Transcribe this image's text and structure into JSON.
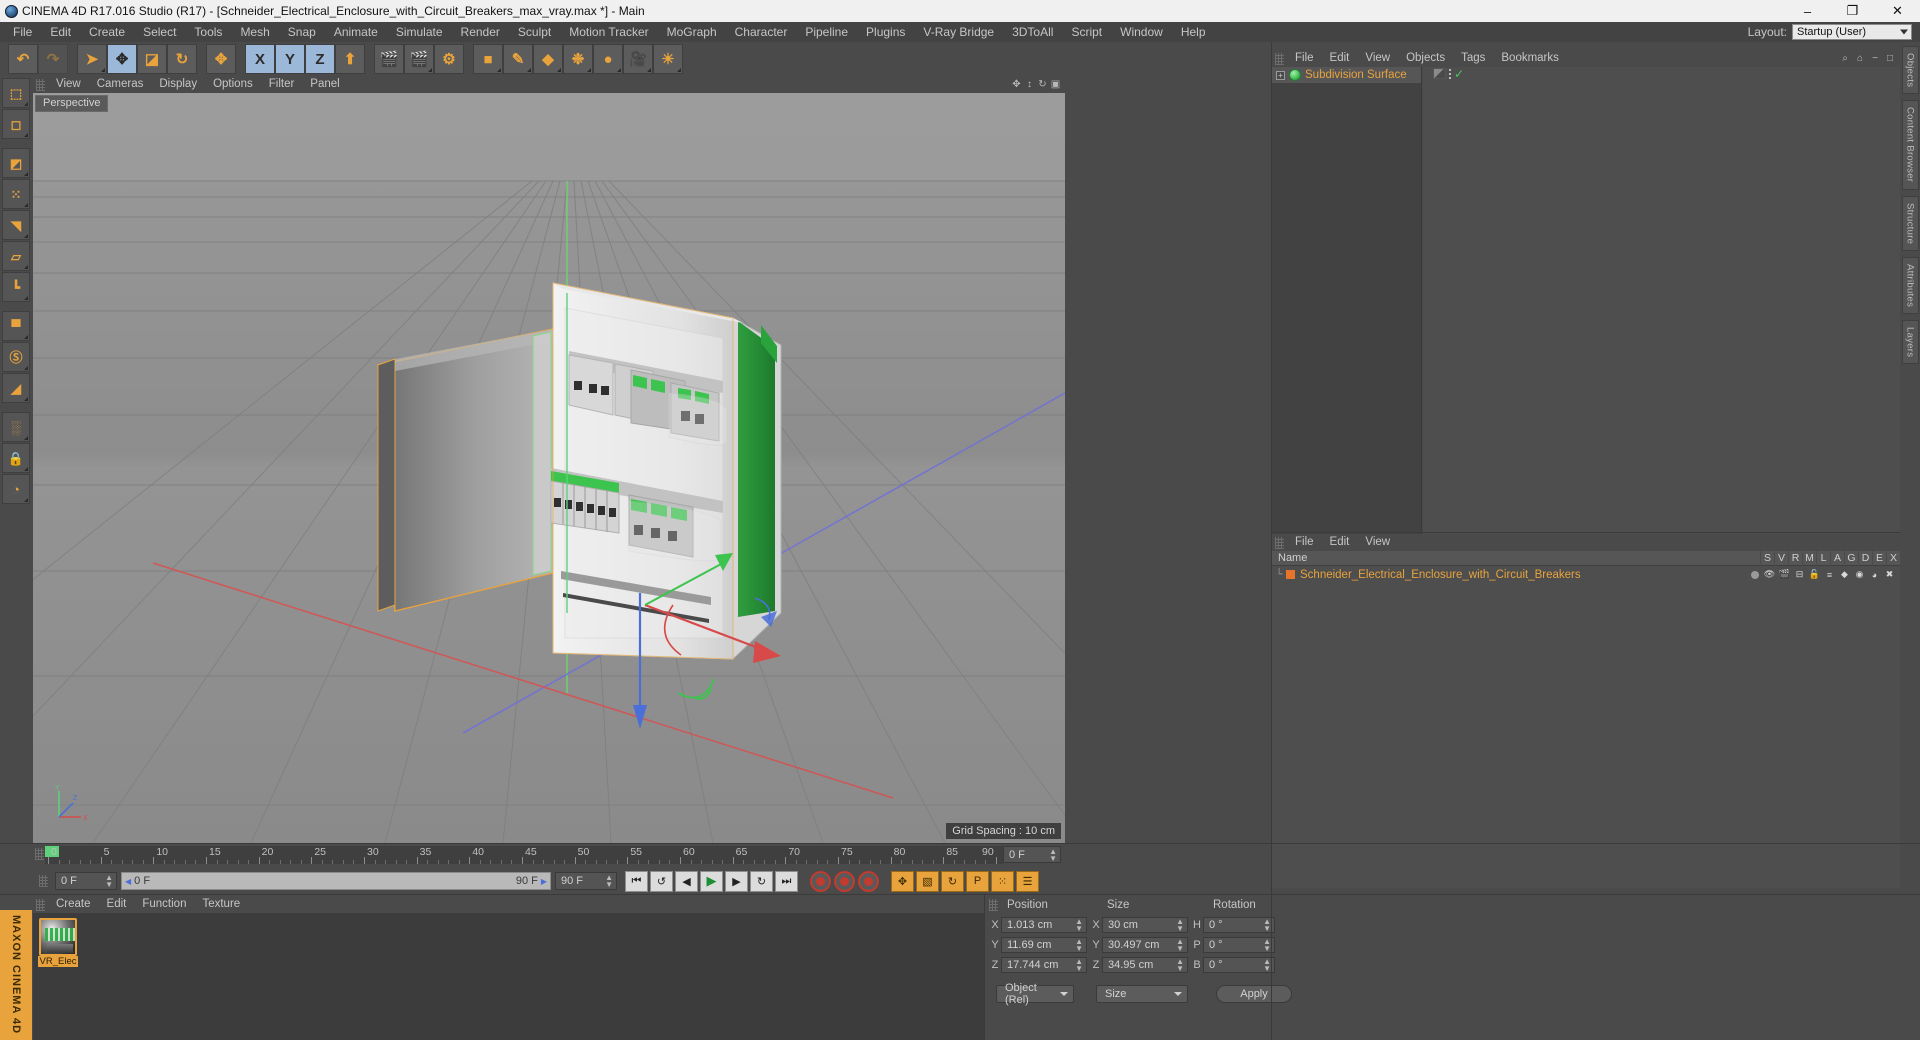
{
  "titlebar": {
    "title": "CINEMA 4D R17.016 Studio (R17) - [Schneider_Electrical_Enclosure_with_Circuit_Breakers_max_vray.max *] - Main",
    "minimize": "–",
    "maximize": "❐",
    "close": "✕"
  },
  "menubar": {
    "items": [
      "File",
      "Edit",
      "Create",
      "Select",
      "Tools",
      "Mesh",
      "Snap",
      "Animate",
      "Simulate",
      "Render",
      "Sculpt",
      "Motion Tracker",
      "MoGraph",
      "Character",
      "Pipeline",
      "Plugins",
      "V-Ray Bridge",
      "3DToAll",
      "Script",
      "Window",
      "Help"
    ],
    "layout_label": "Layout:",
    "layout_value": "Startup (User)"
  },
  "toolbar": {
    "groups": [
      {
        "buttons": [
          {
            "name": "undo-button",
            "glyph": "↶",
            "state": "normal"
          },
          {
            "name": "redo-button",
            "glyph": "↷",
            "state": "disabled"
          }
        ]
      },
      {
        "buttons": [
          {
            "name": "live-selection-tool",
            "glyph": "➤",
            "state": "normal",
            "menu": true
          },
          {
            "name": "move-tool",
            "glyph": "✥",
            "state": "selected"
          },
          {
            "name": "scale-tool",
            "glyph": "◪",
            "state": "normal"
          },
          {
            "name": "rotate-tool",
            "glyph": "↻",
            "state": "normal"
          }
        ]
      },
      {
        "buttons": [
          {
            "name": "world-object-axis-toggle",
            "glyph": "✥",
            "state": "normal"
          }
        ]
      },
      {
        "buttons": [
          {
            "name": "lock-x-axis",
            "glyph": "X",
            "state": "selected"
          },
          {
            "name": "lock-y-axis",
            "glyph": "Y",
            "state": "selected"
          },
          {
            "name": "lock-z-axis",
            "glyph": "Z",
            "state": "selected"
          },
          {
            "name": "world-coordinate-toggle",
            "glyph": "⬆",
            "state": "normal"
          }
        ]
      },
      {
        "buttons": [
          {
            "name": "render-view-button",
            "glyph": "🎬",
            "state": "normal"
          },
          {
            "name": "render-to-picture-viewer-button",
            "glyph": "🎬",
            "state": "normal",
            "menu": true
          },
          {
            "name": "render-settings-button",
            "glyph": "⚙",
            "state": "normal"
          }
        ]
      },
      {
        "buttons": [
          {
            "name": "add-cube-button",
            "glyph": "■",
            "state": "normal",
            "menu": true
          },
          {
            "name": "add-spline-button",
            "glyph": "✎",
            "state": "normal",
            "menu": true
          },
          {
            "name": "add-generator-button",
            "glyph": "◆",
            "state": "normal",
            "menu": true
          },
          {
            "name": "add-deformer-button",
            "glyph": "❉",
            "state": "normal",
            "menu": true
          },
          {
            "name": "add-scene-object-button",
            "glyph": "●",
            "state": "normal",
            "menu": true
          },
          {
            "name": "add-camera-button",
            "glyph": "🎥",
            "state": "normal",
            "menu": true
          },
          {
            "name": "add-light-button",
            "glyph": "☀",
            "state": "normal",
            "menu": true
          }
        ]
      }
    ]
  },
  "left_palette": {
    "buttons": [
      {
        "name": "make-editable-tool",
        "glyph": "⬚"
      },
      {
        "name": "model-mode-tool",
        "glyph": "◻"
      },
      {
        "name": "texture-mode-tool",
        "glyph": "◩"
      },
      {
        "name": "points-mode-tool",
        "glyph": "⁙"
      },
      {
        "name": "edges-mode-tool",
        "glyph": "◥"
      },
      {
        "name": "polygons-mode-tool",
        "glyph": "▱"
      },
      {
        "name": "axis-mode-tool",
        "glyph": "┗"
      },
      {
        "name": "viewport-solo-tool",
        "glyph": "▀"
      },
      {
        "name": "enable-axis-tool",
        "glyph": "Ⓢ"
      },
      {
        "name": "workplane-tool",
        "glyph": "◢"
      },
      {
        "name": "snap-toggle-tool",
        "glyph": "░"
      },
      {
        "name": "lock-workplane-tool",
        "glyph": "🔒"
      },
      {
        "name": "python-tool",
        "glyph": "◔"
      }
    ],
    "brand": "MAXON CINEMA 4D"
  },
  "viewport": {
    "menu_items": [
      "View",
      "Cameras",
      "Display",
      "Options",
      "Filter",
      "Panel"
    ],
    "corner_icons": [
      "move-view-icon",
      "scale-view-icon",
      "rotate-view-icon",
      "maximize-view-icon"
    ],
    "label": "Perspective",
    "grid_spacing": "Grid Spacing : 10 cm",
    "axis_labels": {
      "x": "X",
      "y": "Y",
      "z": "Z"
    }
  },
  "right_strip": {
    "tabs": [
      "Objects",
      "Content Browser",
      "Structure",
      "Attributes",
      "Layers"
    ]
  },
  "content_browser": {
    "menu_items": [
      "File",
      "Edit",
      "View",
      "Objects",
      "Tags",
      "Bookmarks"
    ],
    "tools": [
      "search-icon",
      "home-icon",
      "minimize-icon",
      "maximize-icon"
    ],
    "item_label": "Subdivision Surface",
    "expand_glyph": "+"
  },
  "object_manager": {
    "menu_items": [
      "File",
      "Edit",
      "View"
    ],
    "columns": [
      "Name",
      "S",
      "V",
      "R",
      "M",
      "L",
      "A",
      "G",
      "D",
      "E",
      "X"
    ],
    "rows": [
      {
        "name": "Schneider_Electrical_Enclosure_with_Circuit_Breakers"
      }
    ]
  },
  "timeline": {
    "ticks": [
      {
        "label": "0",
        "value": 0
      },
      {
        "label": "5",
        "value": 5
      },
      {
        "label": "10",
        "value": 10
      },
      {
        "label": "15",
        "value": 15
      },
      {
        "label": "20",
        "value": 20
      },
      {
        "label": "25",
        "value": 25
      },
      {
        "label": "30",
        "value": 30
      },
      {
        "label": "35",
        "value": 35
      },
      {
        "label": "40",
        "value": 40
      },
      {
        "label": "45",
        "value": 45
      },
      {
        "label": "50",
        "value": 50
      },
      {
        "label": "55",
        "value": 55
      },
      {
        "label": "60",
        "value": 60
      },
      {
        "label": "65",
        "value": 65
      },
      {
        "label": "70",
        "value": 70
      },
      {
        "label": "75",
        "value": 75
      },
      {
        "label": "80",
        "value": 80
      },
      {
        "label": "85",
        "value": 85
      },
      {
        "label": "90",
        "value": 90
      }
    ],
    "range_min": 0,
    "range_max": 90,
    "current_frame_field": "0 F"
  },
  "playback": {
    "current_frame": "0 F",
    "range_start": "0 F",
    "range_end": "90 F",
    "end_frame": "90 F",
    "buttons": [
      {
        "name": "go-to-start-button",
        "glyph": "⏮"
      },
      {
        "name": "step-back-keyframe-button",
        "glyph": "↺"
      },
      {
        "name": "step-back-frame-button",
        "glyph": "◀"
      },
      {
        "name": "play-button",
        "glyph": "▶"
      },
      {
        "name": "step-forward-frame-button",
        "glyph": "▶"
      },
      {
        "name": "step-forward-keyframe-button",
        "glyph": "↻"
      },
      {
        "name": "go-to-end-button",
        "glyph": "⏭"
      }
    ],
    "record_buttons": [
      {
        "name": "record-active-objects-button"
      },
      {
        "name": "autokeying-button"
      },
      {
        "name": "keyframe-selection-button"
      }
    ],
    "key_toggles": [
      {
        "name": "position-key-toggle",
        "glyph": "✥"
      },
      {
        "name": "scale-key-toggle",
        "glyph": "▧"
      },
      {
        "name": "rotation-key-toggle",
        "glyph": "↻"
      },
      {
        "name": "parameter-key-toggle",
        "glyph": "P"
      },
      {
        "name": "point-level-animation-toggle",
        "glyph": "⁙"
      },
      {
        "name": "timeline-settings-button",
        "glyph": "☰"
      }
    ]
  },
  "material_manager": {
    "menu_items": [
      "Create",
      "Edit",
      "Function",
      "Texture"
    ],
    "materials": [
      {
        "name": "VR_Elec"
      }
    ]
  },
  "coordinates": {
    "headers": {
      "position": "Position",
      "size": "Size",
      "rotation": "Rotation"
    },
    "rows": [
      {
        "pos_axis": "X",
        "pos_value": "1.013 cm",
        "size_axis": "X",
        "size_value": "30 cm",
        "rot_axis": "H",
        "rot_value": "0 °"
      },
      {
        "pos_axis": "Y",
        "pos_value": "11.69 cm",
        "size_axis": "Y",
        "size_value": "30.497 cm",
        "rot_axis": "P",
        "rot_value": "0 °"
      },
      {
        "pos_axis": "Z",
        "pos_value": "17.744 cm",
        "size_axis": "Z",
        "size_value": "34.95 cm",
        "rot_axis": "B",
        "rot_value": "0 °"
      }
    ],
    "mode_dropdown": "Object (Rel)",
    "size_dropdown": "Size",
    "apply_button": "Apply"
  },
  "colors": {
    "accent_orange": "#e8a33d",
    "selection_blue": "#9cb8d8",
    "panel_bg": "#4a4a4a",
    "viewport_bg": "#8f8f8f",
    "green": "#3cb84e"
  }
}
